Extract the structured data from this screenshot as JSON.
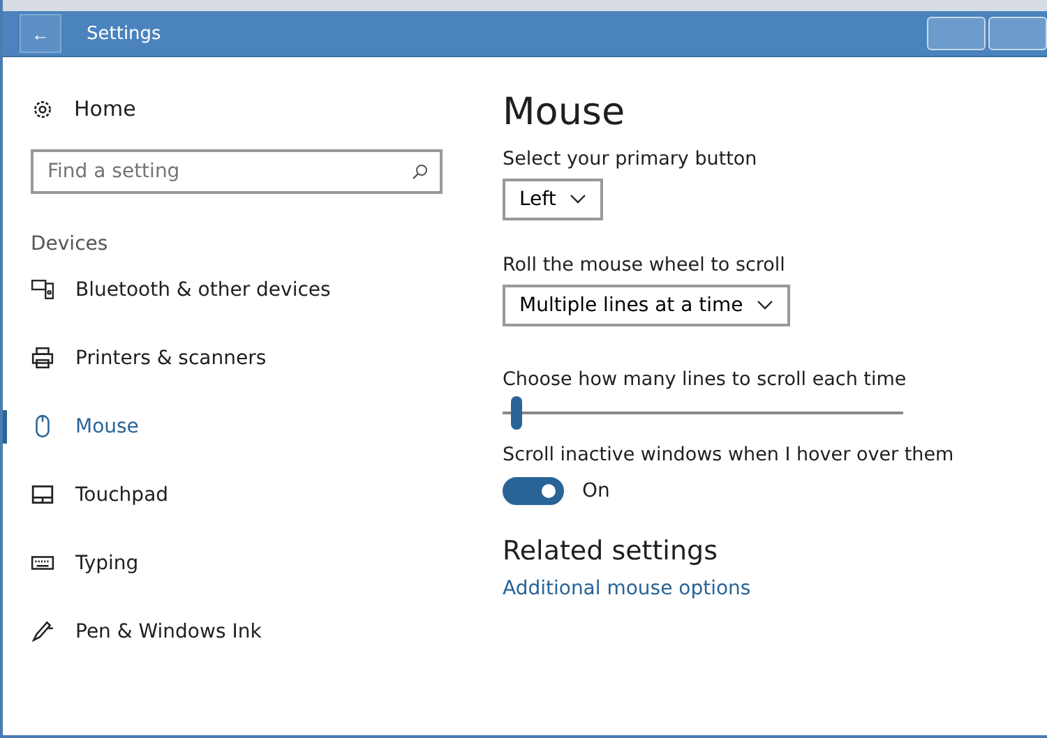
{
  "window": {
    "title": "Settings",
    "back": "←"
  },
  "sidebar": {
    "home": "Home",
    "search": {
      "placeholder": "Find a setting"
    },
    "section": "Devices",
    "items": [
      {
        "label": "Bluetooth & other devices",
        "kind": "bluetooth",
        "selected": false
      },
      {
        "label": "Printers & scanners",
        "kind": "printer",
        "selected": false
      },
      {
        "label": "Mouse",
        "kind": "mouse",
        "selected": true
      },
      {
        "label": "Touchpad",
        "kind": "touchpad",
        "selected": false
      },
      {
        "label": "Typing",
        "kind": "keyboard",
        "selected": false
      },
      {
        "label": "Pen & Windows Ink",
        "kind": "pen",
        "selected": false
      }
    ]
  },
  "main": {
    "title": "Mouse",
    "primary_button": {
      "label": "Select your primary button",
      "value": "Left"
    },
    "wheel": {
      "label": "Roll the mouse wheel to scroll",
      "value": "Multiple lines at a time"
    },
    "lines": {
      "label": "Choose how many lines to scroll each time",
      "level": 0.035
    },
    "inactive": {
      "label": "Scroll inactive windows when I hover over them",
      "on": true,
      "state": "On"
    },
    "related": {
      "title": "Related settings",
      "link": "Additional mouse options"
    }
  }
}
